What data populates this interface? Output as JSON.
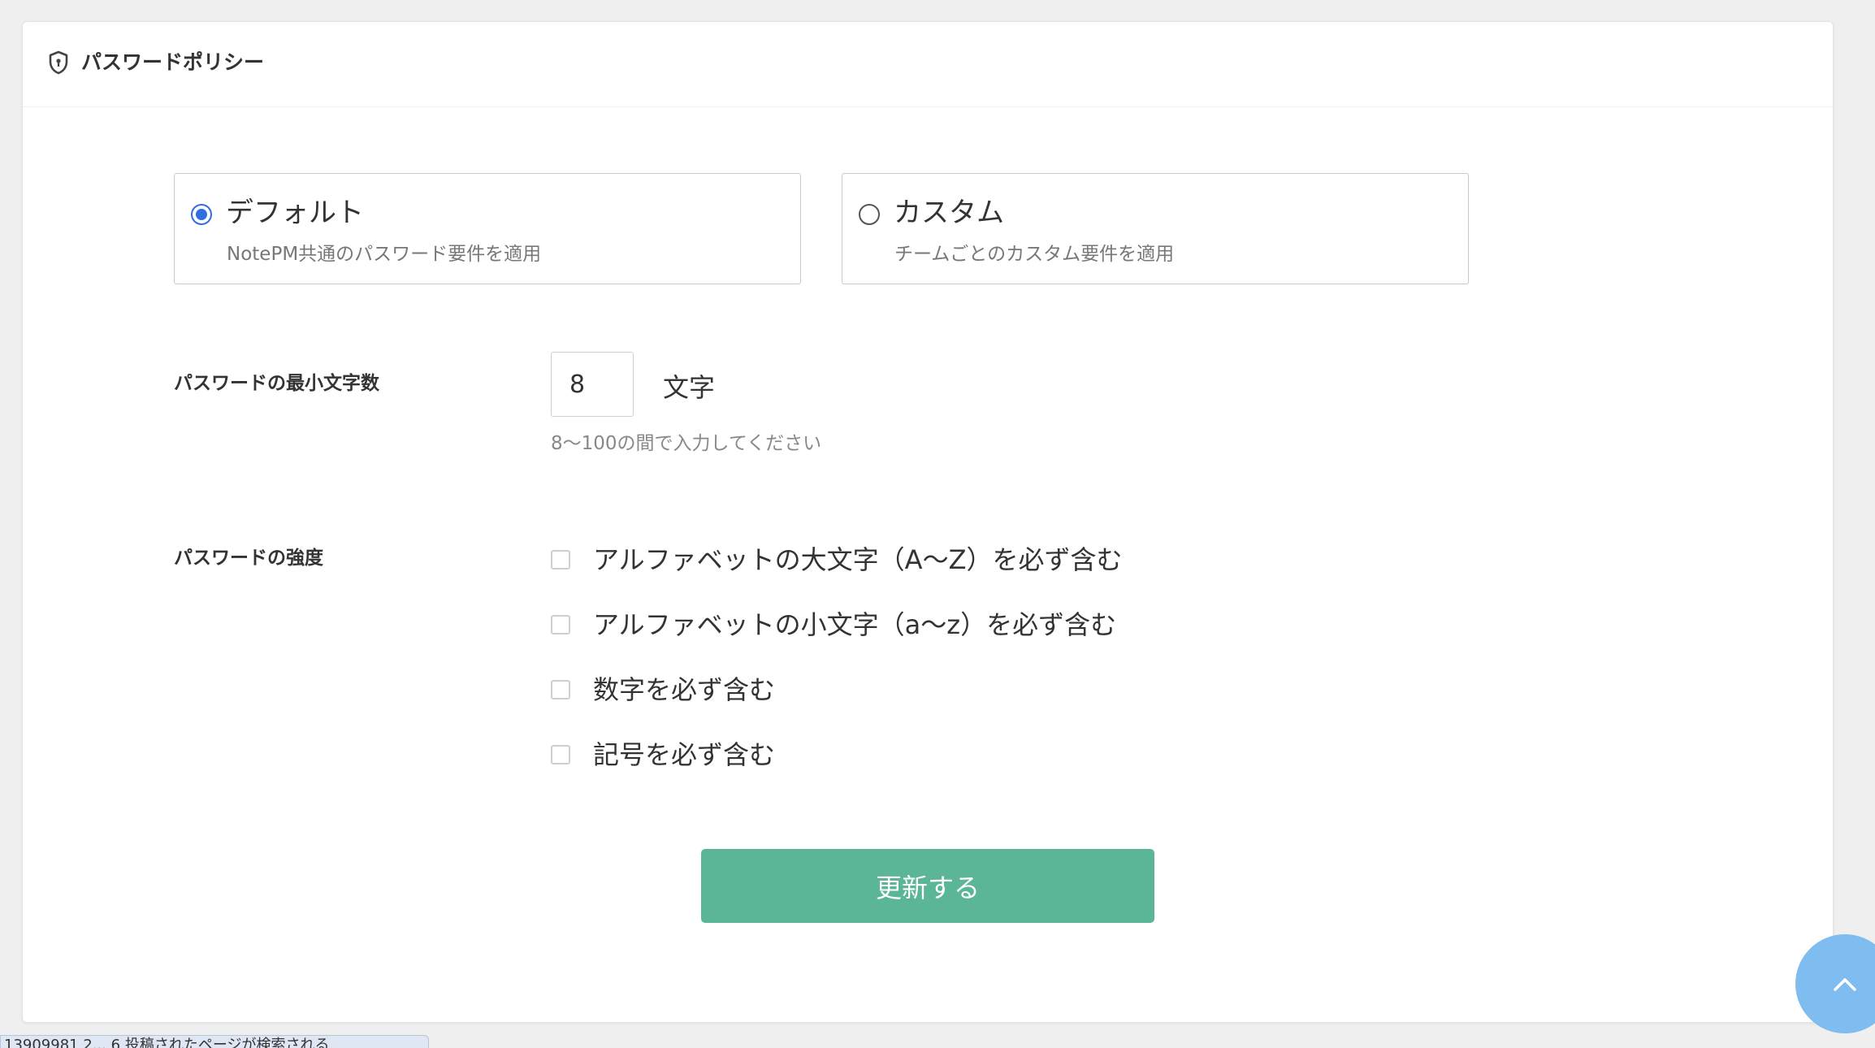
{
  "header": {
    "title": "パスワードポリシー",
    "icon": "shield-icon"
  },
  "policy_options": [
    {
      "title": "デフォルト",
      "description": "NotePM共通のパスワード要件を適用",
      "selected": true
    },
    {
      "title": "カスタム",
      "description": "チームごとのカスタム要件を適用",
      "selected": false
    }
  ],
  "min_length": {
    "label": "パスワードの最小文字数",
    "value": "8",
    "unit": "文字",
    "hint": "8〜100の間で入力してください"
  },
  "strength": {
    "label": "パスワードの強度",
    "options": [
      {
        "label": "アルファベットの大文字（A〜Z）を必ず含む",
        "checked": false
      },
      {
        "label": "アルファベットの小文字（a〜z）を必ず含む",
        "checked": false
      },
      {
        "label": "数字を必ず含む",
        "checked": false
      },
      {
        "label": "記号を必ず含む",
        "checked": false
      }
    ]
  },
  "submit_label": "更新する",
  "scroll_top_icon": "chevron-up-icon",
  "colors": {
    "accent_radio": "#2f6fe0",
    "button": "#5bb597",
    "scroll_button": "#7fbcef"
  },
  "status_text": "13909981 2... 6 投稿されたページが検索される"
}
